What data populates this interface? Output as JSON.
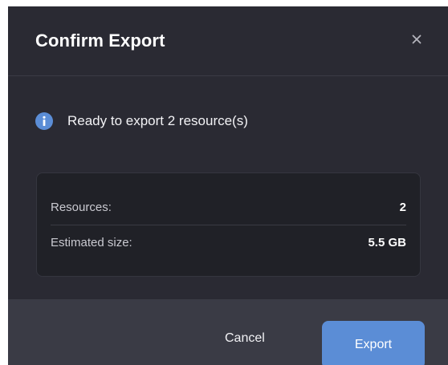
{
  "dialog": {
    "title": "Confirm Export",
    "close_icon": "close-icon",
    "info_icon": "info-icon",
    "info_text": "Ready to export 2 resource(s)",
    "summary": [
      {
        "label": "Resources:",
        "value": "2"
      },
      {
        "label": "Estimated size:",
        "value": "5.5 GB"
      }
    ],
    "cancel_label": "Cancel",
    "export_label": "Export"
  },
  "colors": {
    "dialog_bg": "#2a2a33",
    "card_bg": "#202127",
    "footer_bg": "#3a3b45",
    "accent": "#5b8dd6",
    "info_icon": "#5b8dd6"
  }
}
